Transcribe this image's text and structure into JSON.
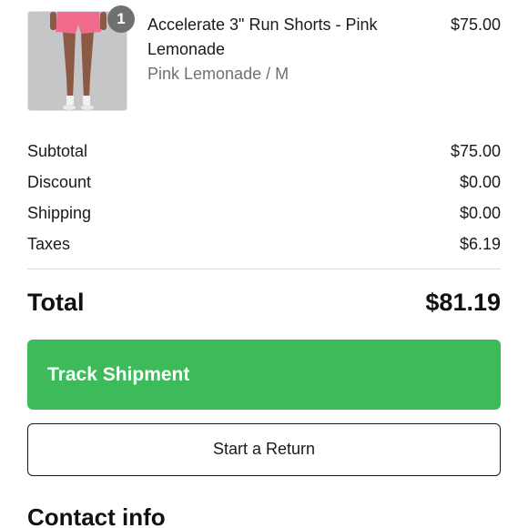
{
  "product": {
    "quantity": "1",
    "title": "Accelerate 3\" Run Shorts - Pink Lemonade",
    "variant": "Pink Lemonade / M",
    "price": "$75.00",
    "image_colors": {
      "shorts": "#f06b8c",
      "skin": "#8a5a45",
      "background": "#c6c6c8"
    }
  },
  "summary": {
    "rows": [
      {
        "label": "Subtotal",
        "value": "$75.00"
      },
      {
        "label": "Discount",
        "value": "$0.00"
      },
      {
        "label": "Shipping",
        "value": "$0.00"
      },
      {
        "label": "Taxes",
        "value": "$6.19"
      }
    ],
    "total_label": "Total",
    "total_value": "$81.19"
  },
  "actions": {
    "track_label": "Track Shipment",
    "return_label": "Start a Return"
  },
  "contact": {
    "title": "Contact info"
  },
  "colors": {
    "primary_button": "#3dbb5a",
    "badge": "#707070",
    "muted_text": "#707070"
  }
}
